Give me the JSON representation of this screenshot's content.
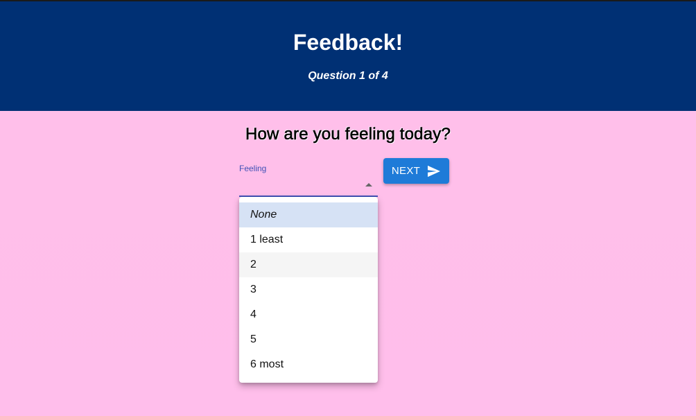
{
  "header": {
    "title": "Feedback!",
    "subtitle": "Question 1 of 4",
    "background": "#003074"
  },
  "question": {
    "text": "How are you feeling today?"
  },
  "select": {
    "label": "Feeling",
    "accent": "#3f51b5",
    "options": [
      {
        "label": "None",
        "state": "selected"
      },
      {
        "label": "1 least",
        "state": ""
      },
      {
        "label": "2",
        "state": "hover"
      },
      {
        "label": "3",
        "state": ""
      },
      {
        "label": "4",
        "state": ""
      },
      {
        "label": "5",
        "state": ""
      },
      {
        "label": "6 most",
        "state": ""
      }
    ]
  },
  "next_button": {
    "label": "NEXT",
    "icon": "send-icon",
    "color": "#1e7bd8"
  },
  "page": {
    "background": "#ffbfea"
  }
}
